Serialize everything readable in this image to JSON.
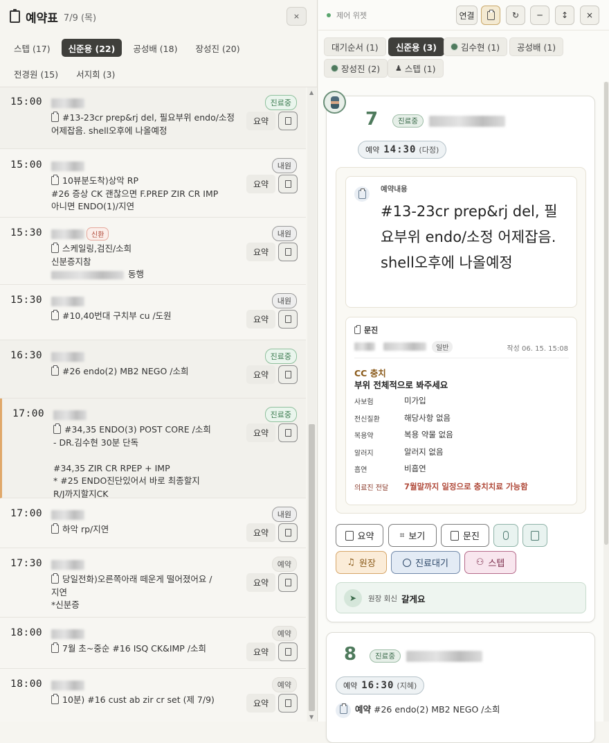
{
  "left": {
    "title": "예약표",
    "date": "7/9 (목)",
    "close": "×",
    "tabs": [
      "스텝 (17)",
      "신준용 (22)",
      "공성배 (18)",
      "장성진 (20)",
      "전경원 (15)",
      "서지희 (3)"
    ],
    "active_tab": 1,
    "summary_label": "요약",
    "appointments": [
      {
        "time": "15:00",
        "status": "진료중",
        "note": "#13-23cr prep&rj del, 필요부위 endo/소정\n어제잡음. shell오후에 나올예정"
      },
      {
        "time": "15:00",
        "status": "내원",
        "note": "10뷰분도착)상악 RP\n#26 증상 CK 괜찮으면 F.PREP ZIR CR IMP\n아니면 ENDO(1)/지연"
      },
      {
        "time": "15:30",
        "status": "내원",
        "new": "신환",
        "note": "스케일링,검진/소희\n신분증지참",
        "note_extra": "동행"
      },
      {
        "time": "15:30",
        "status": "내원",
        "note": "#10,40번대 구치부 cu /도원"
      },
      {
        "time": "16:30",
        "status": "진료중",
        "note": "#26 endo(2) MB2 NEGO /소희"
      },
      {
        "time": "17:00",
        "status": "진료중",
        "note": "#34,35 ENDO(3) POST CORE /소희\n- DR.김수현 30분 단독\n\n#34,35 ZIR CR RPEP + IMP\n* #25 ENDO진단있어서 바로 최종할지\nR/J까지할지CK"
      },
      {
        "time": "17:00",
        "status": "내원",
        "note": "하악 rp/지연"
      },
      {
        "time": "17:30",
        "status": "예약",
        "note": "당일전화)오른쪽아래 떼운게 떨어졌어요 /\n지연\n*신분증"
      },
      {
        "time": "18:00",
        "status": "예약",
        "note": "7월 초~중순 #16 ISQ CK&IMP /소희"
      },
      {
        "time": "18:00",
        "status": "예약",
        "note": "10분) #16 cust ab zir cr set (제 7/9)"
      }
    ]
  },
  "right": {
    "widget_title": "제어 위젯",
    "btn_connect": "연결",
    "btn_refresh": "↻",
    "btn_min": "─",
    "btn_resize": "↕",
    "btn_close": "×",
    "tabs": [
      "대기순서 (1)",
      "신준용 (3)",
      "김수현 (1)",
      "공성배 (1)",
      "장성진 (2)",
      "스텝 (1)"
    ],
    "active_tab": 1,
    "card1": {
      "number": "7",
      "status": "진료중",
      "appt_label": "예약",
      "appt_time": "14:30",
      "appt_by": "(다정)",
      "content_label": "예약내용",
      "content": "#13-23cr prep&rj del, 필요부위 endo/소정 어제잡음. shell오후에 나올예정",
      "munjin_label": "문진",
      "munjin_type": "일반",
      "munjin_date": "작성 06. 15. 15:08",
      "cc": "CC 충치",
      "cc_detail": "부위 전체적으로 봐주세요",
      "rows": [
        {
          "k": "사보험",
          "v": "미가입"
        },
        {
          "k": "전신질환",
          "v": "해당사항 없음"
        },
        {
          "k": "복용약",
          "v": "복용 약물 없음"
        },
        {
          "k": "알러지",
          "v": "알러지 없음"
        },
        {
          "k": "흡연",
          "v": "비흡연"
        }
      ],
      "deliver_label": "의료진 전달",
      "deliver": "7월말까지 일정으로 충치치료 가능함",
      "btn_summary": "요약",
      "btn_view": "보기",
      "btn_munjin": "문진",
      "btn_director": "원장",
      "btn_wait": "진료대기",
      "btn_staff": "스텝",
      "reply_label": "원장 회신",
      "reply": "갈게요"
    },
    "card2": {
      "number": "8",
      "status": "진료중",
      "appt_label": "예약",
      "appt_time": "16:30",
      "appt_by": "(지혜)",
      "content_label": "예약",
      "content": "#26 endo(2) MB2 NEGO /소희"
    }
  }
}
